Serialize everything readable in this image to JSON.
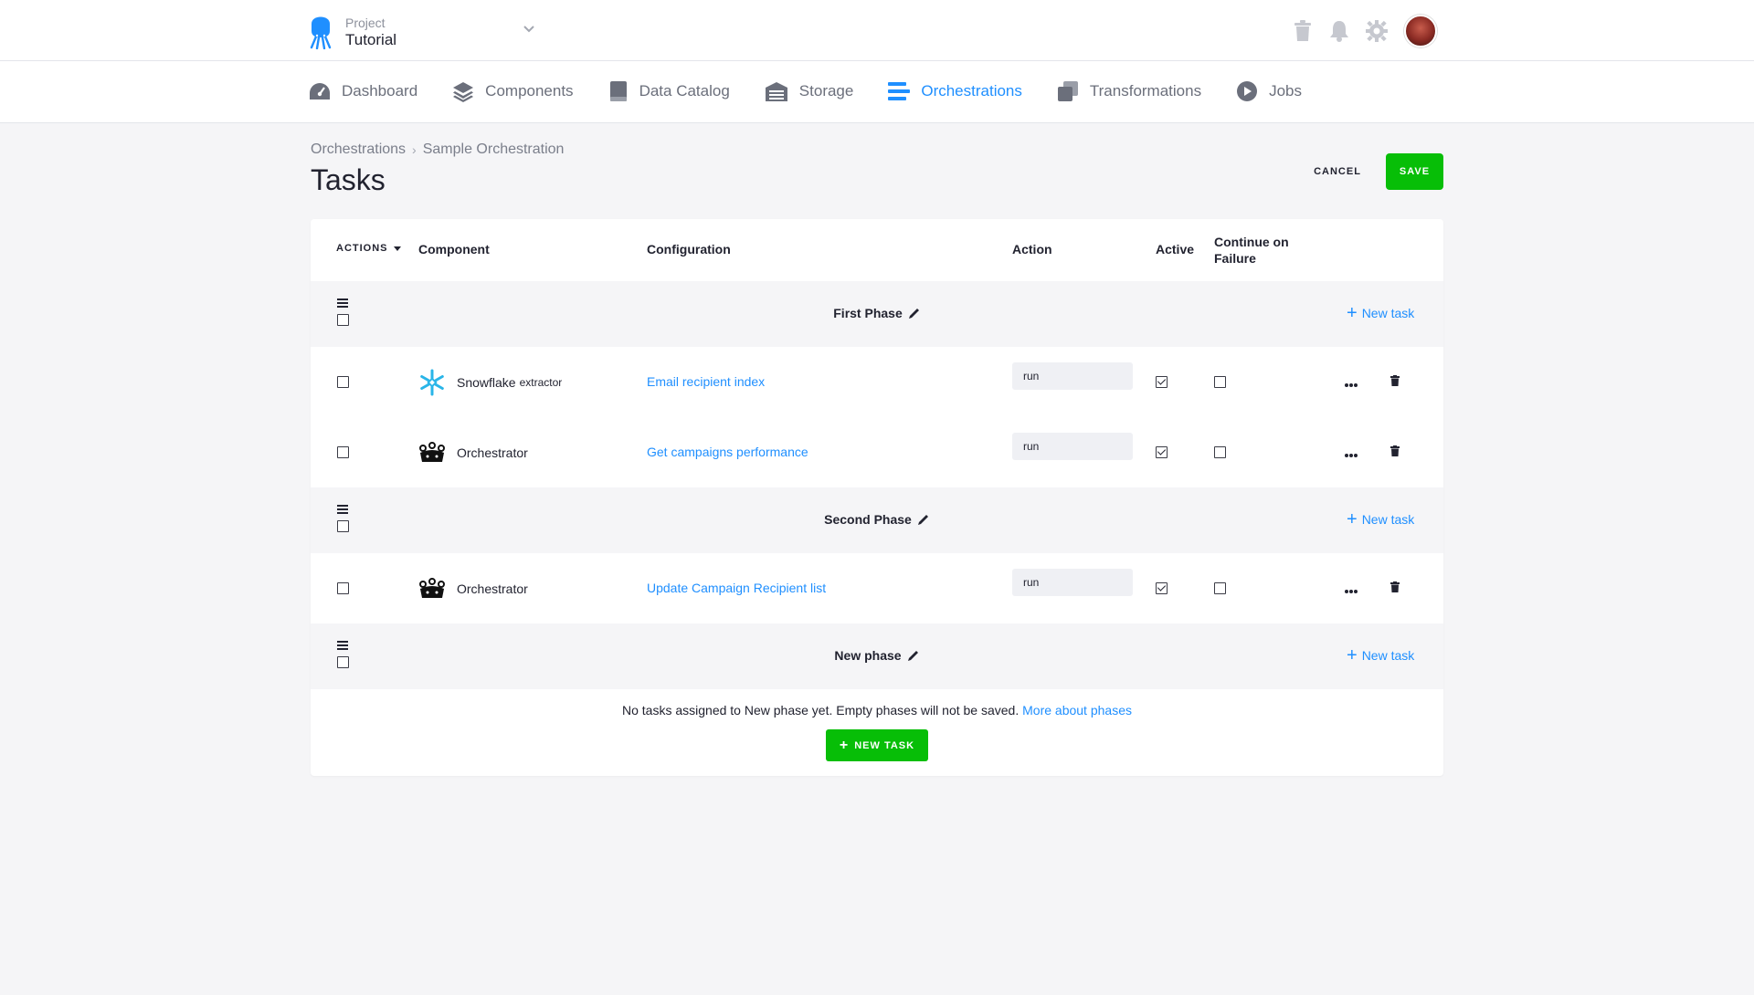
{
  "project": {
    "label": "Project",
    "name": "Tutorial"
  },
  "nav": {
    "items": [
      {
        "label": "Dashboard",
        "icon": "gauge-icon"
      },
      {
        "label": "Components",
        "icon": "layers-icon"
      },
      {
        "label": "Data Catalog",
        "icon": "book-icon"
      },
      {
        "label": "Storage",
        "icon": "warehouse-icon"
      },
      {
        "label": "Orchestrations",
        "icon": "bars-icon",
        "active": true
      },
      {
        "label": "Transformations",
        "icon": "copy-icon"
      },
      {
        "label": "Jobs",
        "icon": "play-icon"
      }
    ]
  },
  "breadcrumb": {
    "parent": "Orchestrations",
    "current": "Sample Orchestration"
  },
  "page": {
    "title": "Tasks"
  },
  "buttons": {
    "cancel": "CANCEL",
    "save": "SAVE",
    "new_task": "NEW TASK"
  },
  "table": {
    "actions_label": "ACTIONS",
    "headers": {
      "component": "Component",
      "configuration": "Configuration",
      "action": "Action",
      "active": "Active",
      "continue_line1": "Continue on",
      "continue_line2": "Failure"
    },
    "phases": [
      {
        "name": "First Phase",
        "new_task_label": "New task",
        "tasks": [
          {
            "component": "Snowflake",
            "component_sub": "extractor",
            "icon": "snowflake-icon",
            "configuration": "Email recipient index",
            "action": "run",
            "active": true,
            "continue_on_failure": false
          },
          {
            "component": "Orchestrator",
            "component_sub": "",
            "icon": "orchestrator-icon",
            "configuration": "Get campaigns performance",
            "action": "run",
            "active": true,
            "continue_on_failure": false
          }
        ]
      },
      {
        "name": "Second Phase",
        "new_task_label": "New task",
        "tasks": [
          {
            "component": "Orchestrator",
            "component_sub": "",
            "icon": "orchestrator-icon",
            "configuration": "Update Campaign Recipient list",
            "action": "run",
            "active": true,
            "continue_on_failure": false
          }
        ]
      },
      {
        "name": "New phase",
        "new_task_label": "New task",
        "tasks": []
      }
    ],
    "empty_message": "No tasks assigned to New phase yet. Empty phases will not be saved.",
    "empty_link": "More about phases"
  },
  "colors": {
    "accent": "#1f8fff",
    "success": "#07be07",
    "background": "#f5f5f7"
  }
}
